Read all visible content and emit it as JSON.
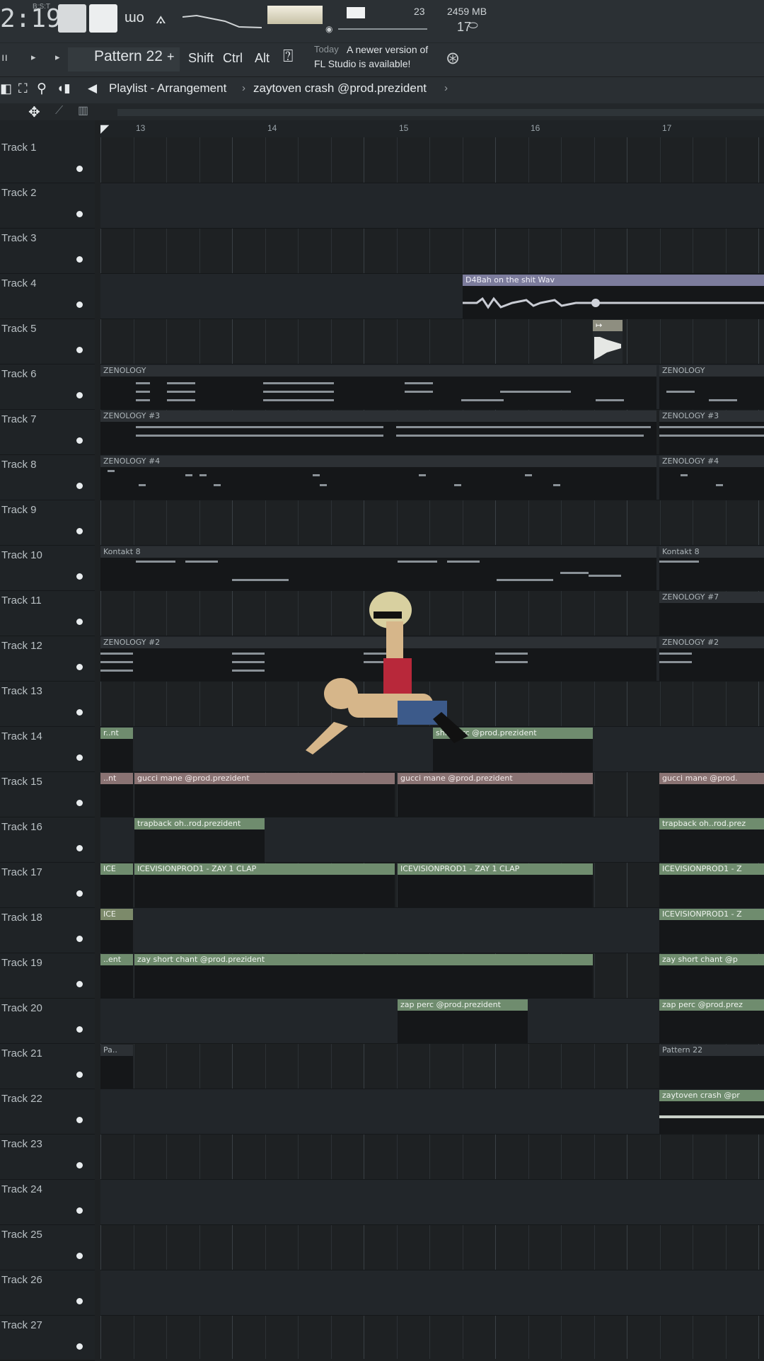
{
  "top": {
    "time": "2:19",
    "time_sub": "B:S:T",
    "cpu": "23",
    "memory": "2459 MB",
    "polyphony": "17"
  },
  "toolbar": {
    "pattern": "Pattern 22",
    "plus": "+",
    "shift": "Shift",
    "ctrl": "Ctrl",
    "alt": "Alt",
    "hint_today": "Today",
    "hint_line1": "A newer version of",
    "hint_line2": "FL Studio is available!"
  },
  "title": {
    "window": "Playlist - Arrangement",
    "sep": "›",
    "project": "zaytoven crash @prod.prezident"
  },
  "ruler": {
    "bars": [
      "13",
      "14",
      "15",
      "16",
      "17"
    ]
  },
  "tracks": [
    "Track 1",
    "Track 2",
    "Track 3",
    "Track 4",
    "Track 5",
    "Track 6",
    "Track 7",
    "Track 8",
    "Track 9",
    "Track 10",
    "Track 11",
    "Track 12",
    "Track 13",
    "Track 14",
    "Track 15",
    "Track 16",
    "Track 17",
    "Track 18",
    "Track 19",
    "Track 20",
    "Track 21",
    "Track 22",
    "Track 23",
    "Track 24",
    "Track 25",
    "Track 26",
    "Track 27"
  ],
  "clips": {
    "t4": "D4Bah on the shit Wav",
    "t6a": "ZENOLOGY",
    "t6b": "ZENOLOGY",
    "t7a": "ZENOLOGY #3",
    "t7b": "ZENOLOGY #3",
    "t8a": "ZENOLOGY #4",
    "t8b": "ZENOLOGY #4",
    "t10a": "Kontakt 8",
    "t10b": "Kontakt 8",
    "t11": "ZENOLOGY #7",
    "t12a": "ZENOLOGY #2",
    "t12b": "ZENOLOGY #2",
    "t14": "shit perc @prod.prezident",
    "t15a": "gucci mane @prod.prezident",
    "t15b": "gucci mane @prod.prezident",
    "t15c": "gucci mane @prod.",
    "t16a": "trapback oh..rod.prezident",
    "t16b": "trapback oh..rod.prez",
    "t17a": "ICEVISIONPROD1 - ZAY 1 CLAP",
    "t17b": "ICEVISIONPROD1 - ZAY 1 CLAP",
    "t17c": "ICEVISIONPROD1 - Z",
    "t18": "ICEVISIONPROD1 - Z",
    "t19a": "zay short chant @prod.prezident",
    "t19b": "zay short chant @p",
    "t20a": "zap perc @prod.prezident",
    "t20b": "zap perc @prod.prez",
    "t21": "Pattern 22",
    "t22": "zaytoven crash @pr"
  },
  "colors": {
    "audio_clip": "#6f8c6e",
    "vocal_clip": "#8a7373",
    "wav_clip": "#7c7c9c",
    "pattern_clip": "#2c3034"
  }
}
